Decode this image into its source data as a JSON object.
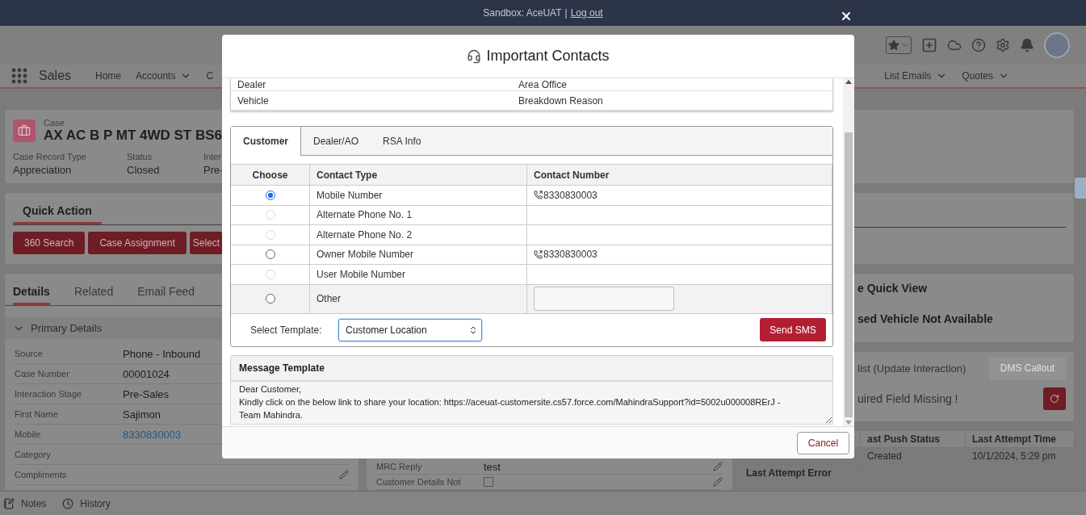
{
  "banner": {
    "sandbox": "Sandbox: AceUAT",
    "separator": "|",
    "logout": "Log out"
  },
  "nav": {
    "app": "Sales",
    "items": [
      {
        "label": "Home",
        "dropdown": false
      },
      {
        "label": "Accounts",
        "dropdown": true
      },
      {
        "label": "C",
        "dropdown": false
      }
    ],
    "right_items": [
      {
        "label": "List Emails",
        "dropdown": true
      },
      {
        "label": "Quotes",
        "dropdown": true
      }
    ]
  },
  "case": {
    "type": "Case",
    "title": "AX AC B P MT 4WD ST BS6",
    "fields": [
      {
        "label": "Case Record Type",
        "value": "Appreciation"
      },
      {
        "label": "Status",
        "value": "Closed"
      },
      {
        "label": "Inter",
        "value": "Pre-"
      }
    ]
  },
  "quick_action": {
    "title": "Quick Action",
    "buttons": [
      "360 Search",
      "Case Assignment",
      "Select"
    ]
  },
  "details": {
    "tabs": [
      {
        "label": "Details",
        "selected": true
      },
      {
        "label": "Related",
        "selected": false
      },
      {
        "label": "Email Feed",
        "selected": false
      }
    ],
    "section": {
      "title": "Primary Details",
      "expanded": true
    },
    "fields": [
      {
        "label": "Source",
        "value": "Phone - Inbound",
        "kind": "text",
        "editable": false
      },
      {
        "label": "Case Number",
        "value": "00001024",
        "kind": "text",
        "editable": false
      },
      {
        "label": "Interaction Stage",
        "value": "Pre-Sales",
        "kind": "text",
        "editable": false
      },
      {
        "label": "First Name",
        "value": "Sajimon",
        "kind": "text",
        "editable": false
      },
      {
        "label": "Mobile",
        "value": "8330830003",
        "kind": "link",
        "editable": false
      },
      {
        "label": "Category",
        "kind": "text",
        "editable": true
      },
      {
        "label": "Compliments",
        "kind": "text",
        "editable": true
      }
    ]
  },
  "middle_fields": [
    {
      "label": "MRC Reply",
      "value": "test",
      "kind": "text"
    },
    {
      "label": "Customer Details Not",
      "kind": "checkbox",
      "checked": false
    }
  ],
  "quick_view": {
    "title": "e Quick View",
    "message": "sed Vehicle Not Available"
  },
  "dms": {
    "title": "list (Update Interaction)",
    "button": {
      "label": "DMS Callout",
      "disabled": true
    },
    "error": "uired Field Missing !"
  },
  "push_table": {
    "columns": [
      "ast Push Status",
      "Last Attempt Time"
    ],
    "rows": [
      {
        "cells": [
          "Created",
          "10/1/2024, 5:29 pm"
        ]
      },
      {
        "heading": "Last Attempt Error"
      }
    ]
  },
  "footer": {
    "items": [
      {
        "label": "Notes",
        "kind": "notes"
      },
      {
        "label": "History",
        "kind": "history"
      }
    ]
  },
  "modal": {
    "title": "Important Contacts",
    "info_rows": [
      {
        "left": "Dealer",
        "right": "Area Office"
      },
      {
        "left": "Vehicle",
        "right": "Breakdown Reason"
      }
    ],
    "tabs": [
      {
        "label": "Customer",
        "selected": true
      },
      {
        "label": "Dealer/AO",
        "selected": false
      },
      {
        "label": "RSA Info",
        "selected": false
      }
    ],
    "columns": [
      "Choose",
      "Contact Type",
      "Contact Number"
    ],
    "contacts": [
      {
        "type": "Mobile Number",
        "number": "8330830003",
        "selected": true,
        "disabled": false,
        "kind": "phone"
      },
      {
        "type": "Alternate Phone No. 1",
        "selected": false,
        "disabled": true,
        "kind": "phone"
      },
      {
        "type": "Alternate Phone No. 2",
        "selected": false,
        "disabled": true,
        "kind": "phone"
      },
      {
        "type": "Owner Mobile Number",
        "number": "8330830003",
        "selected": false,
        "disabled": false,
        "kind": "phone"
      },
      {
        "type": "User Mobile Number",
        "selected": false,
        "disabled": true,
        "kind": "phone"
      },
      {
        "type": "Other",
        "selected": false,
        "disabled": false,
        "kind": "input"
      }
    ],
    "template": {
      "label": "Select Template:",
      "value": "Customer Location"
    },
    "send_button": "Send SMS",
    "message": {
      "title": "Message Template",
      "lines": [
        "Dear Customer,",
        "Kindly click on the below link to share your location: https://aceuat-customersite.cs57.force.com/MahindraSupport?id=5002u000008RErJ -",
        "Team Mahindra."
      ]
    },
    "cancel": "Cancel"
  }
}
